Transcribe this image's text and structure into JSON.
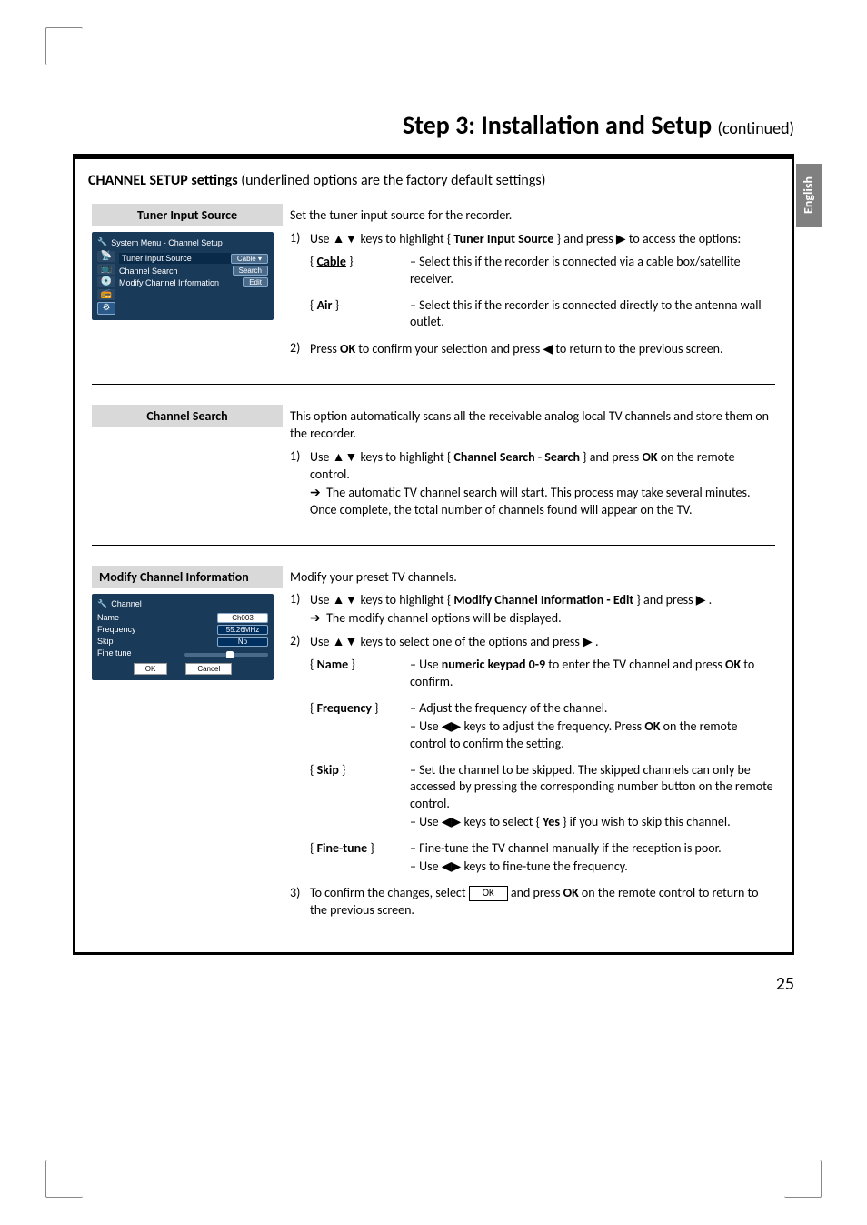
{
  "page": {
    "title": "Step 3: Installation and Setup",
    "continued": "(continued)",
    "sideTab": "English",
    "pageNumber": "25"
  },
  "box": {
    "heading_strong": "CHANNEL SETUP settings",
    "heading_rest": " (underlined options are the factory default settings)"
  },
  "tuner": {
    "heading": "Tuner Input Source",
    "intro": "Set the tuner input source for the recorder.",
    "step1_a": "Use ",
    "step1_b": " keys to highlight  { ",
    "step1_bold": "Tuner Input Source",
    "step1_c": " } and press ",
    "step1_d": " to access the options:",
    "opt_cable": "Cable",
    "opt_cable_desc": "– Select this if the recorder is connected via a cable box/satellite receiver.",
    "opt_air": "Air",
    "opt_air_desc": "– Select this if the recorder is connected directly to the antenna wall outlet.",
    "step2_a": "Press ",
    "step2_ok": "OK",
    "step2_b": " to confirm your selection and press ",
    "step2_c": " to return to the previous screen."
  },
  "osd1": {
    "title": "System Menu - Channel Setup",
    "row1_label": "Tuner Input Source",
    "row1_val": "Cable",
    "row2_label": "Channel Search",
    "row2_val": "Search",
    "row3_label": "Modify Channel Information",
    "row3_val": "Edit"
  },
  "search": {
    "heading": "Channel Search",
    "intro": "This option automatically scans all the receivable analog local TV channels and store them on the recorder.",
    "step1_a": "Use ",
    "step1_b": " keys to highlight  { ",
    "step1_bold": "Channel Search - Search",
    "step1_c": " } and press ",
    "step1_ok": "OK",
    "step1_d": " on the remote control.",
    "arrow_text": "The automatic TV channel search will start. This process may take several minutes. Once complete, the total number of channels found will appear on the TV."
  },
  "modify": {
    "heading": "Modify Channel Information",
    "intro": "Modify your preset TV channels.",
    "step1_a": "Use ",
    "step1_b": " keys to highlight  { ",
    "step1_bold": "Modify Channel Information - Edit",
    "step1_c": " } and press ",
    "step1_d": " .",
    "arrow_text": "The modify channel options will be displayed.",
    "step2_a": "Use ",
    "step2_b": " keys to select one of the options and press ",
    "step2_c": " .",
    "opt_name": "Name",
    "opt_name_desc_a": "– Use ",
    "opt_name_desc_bold": "numeric keypad 0-9",
    "opt_name_desc_b": " to enter the TV channel and press ",
    "opt_name_desc_ok": "OK",
    "opt_name_desc_c": " to confirm.",
    "opt_freq": "Frequency",
    "opt_freq_desc_a": "–  Adjust the frequency of the channel.",
    "opt_freq_desc_b": "– Use ",
    "opt_freq_desc_c": " keys to adjust the frequency. Press ",
    "opt_freq_desc_ok": "OK",
    "opt_freq_desc_d": " on the remote control to confirm the setting.",
    "opt_skip": "Skip",
    "opt_skip_desc_a": "– Set the channel to be skipped. The skipped channels can only be accessed by pressing the corresponding number button on the remote control.",
    "opt_skip_desc_b": "– Use ",
    "opt_skip_desc_c": " keys to select { ",
    "opt_skip_yes": "Yes",
    "opt_skip_desc_d": " } if you wish to skip this channel.",
    "opt_fine": "Fine-tune",
    "opt_fine_desc_a": "– Fine-tune the TV channel manually if the reception is poor.",
    "opt_fine_desc_b": "–  Use ",
    "opt_fine_desc_c": " keys to fine-tune the frequency.",
    "step3_a": "To confirm the changes, select ",
    "step3_ok_btn": "OK",
    "step3_b": " and press ",
    "step3_ok": "OK",
    "step3_c": " on the remote control to return to the previous screen."
  },
  "osd2": {
    "title": "Channel",
    "name_label": "Name",
    "name_val": "Ch003",
    "freq_label": "Frequency",
    "freq_val": "55.26MHz",
    "skip_label": "Skip",
    "skip_val": "No",
    "fine_label": "Fine tune",
    "ok": "OK",
    "cancel": "Cancel"
  }
}
